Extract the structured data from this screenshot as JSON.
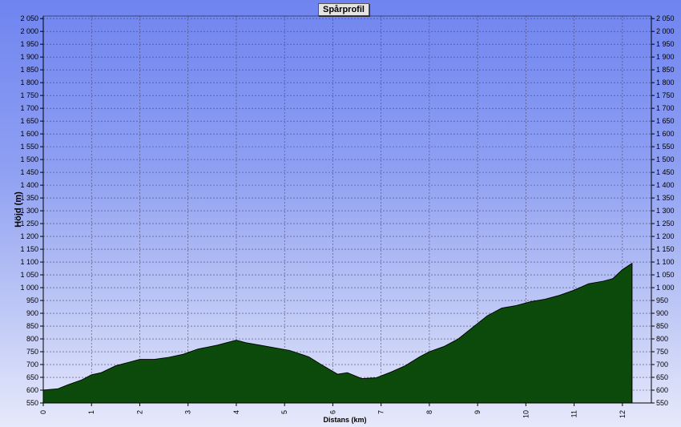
{
  "chart_data": {
    "type": "area",
    "title": "Spårprofil",
    "xlabel": "Distans (km)",
    "ylabel": "Höjd (m)",
    "xlim": [
      0,
      12.6
    ],
    "ylim": [
      550,
      2060
    ],
    "y_ticks": [
      550,
      600,
      650,
      700,
      750,
      800,
      850,
      900,
      950,
      1000,
      1050,
      1100,
      1150,
      1200,
      1250,
      1300,
      1350,
      1400,
      1450,
      1500,
      1550,
      1600,
      1650,
      1700,
      1750,
      1800,
      1850,
      1900,
      1950,
      2000,
      2050
    ],
    "y_tick_labels": [
      "550",
      "600",
      "650",
      "700",
      "750",
      "800",
      "850",
      "900",
      "950",
      "1 000",
      "1 050",
      "1 100",
      "1 150",
      "1 200",
      "1 250",
      "1 300",
      "1 350",
      "1 400",
      "1 450",
      "1 500",
      "1 550",
      "1 600",
      "1 650",
      "1 700",
      "1 750",
      "1 800",
      "1 850",
      "1 900",
      "1 950",
      "2 000",
      "2 050"
    ],
    "x_ticks": [
      0,
      1,
      2,
      3,
      4,
      5,
      6,
      7,
      8,
      9,
      10,
      11,
      12
    ],
    "x_tick_labels": [
      "0",
      "1",
      "2",
      "3",
      "4",
      "5",
      "6",
      "7",
      "8",
      "9",
      "10",
      "11",
      "12"
    ],
    "grid": true,
    "colors": {
      "fill": "#0f5a0f",
      "bar_line": "#052805",
      "background_top": "#6f84f0",
      "background_bottom": "#e6e9fb"
    },
    "x": [
      0,
      0.3,
      0.5,
      0.8,
      1.0,
      1.2,
      1.5,
      1.8,
      2.0,
      2.3,
      2.6,
      2.9,
      3.2,
      3.6,
      4.0,
      4.2,
      4.5,
      4.8,
      5.1,
      5.5,
      5.8,
      6.1,
      6.3,
      6.6,
      6.9,
      7.2,
      7.5,
      7.8,
      8.0,
      8.3,
      8.6,
      8.9,
      9.2,
      9.5,
      9.8,
      10.1,
      10.4,
      10.7,
      11.0,
      11.3,
      11.6,
      11.8,
      12.0,
      12.2
    ],
    "y": [
      600,
      605,
      620,
      640,
      660,
      668,
      695,
      710,
      720,
      720,
      728,
      740,
      760,
      775,
      795,
      785,
      775,
      765,
      755,
      730,
      695,
      662,
      668,
      645,
      648,
      670,
      695,
      730,
      750,
      770,
      800,
      845,
      890,
      920,
      930,
      945,
      955,
      970,
      990,
      1015,
      1025,
      1035,
      1070,
      1095
    ]
  }
}
